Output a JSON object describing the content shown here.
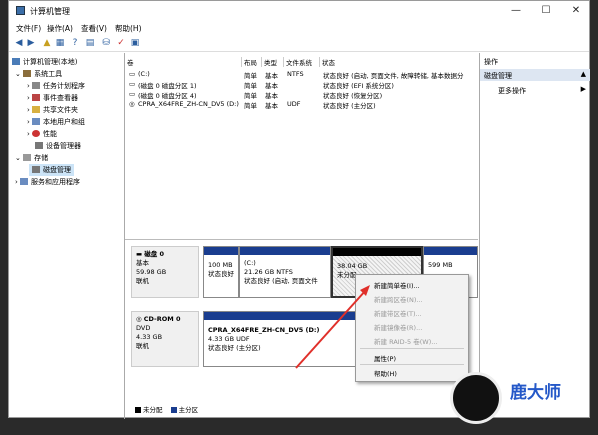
{
  "window": {
    "title": "计算机管理",
    "minimize": "—",
    "maximize": "☐",
    "close": "✕"
  },
  "menu": [
    "文件(F)",
    "操作(A)",
    "查看(V)",
    "帮助(H)"
  ],
  "tree": {
    "root": "计算机管理(本地)",
    "system_tools": "系统工具",
    "task_scheduler": "任务计划程序",
    "event_viewer": "事件查看器",
    "shared_folders": "共享文件夹",
    "local_users": "本地用户和组",
    "performance": "性能",
    "device_manager": "设备管理器",
    "storage": "存储",
    "disk_mgmt": "磁盘管理",
    "services": "服务和应用程序"
  },
  "volumes": {
    "headers": [
      "卷",
      "布局",
      "类型",
      "文件系统",
      "状态"
    ],
    "rows": [
      [
        "(C:)",
        "简单",
        "基本",
        "NTFS",
        "状态良好 (启动, 页面文件, 故障转储, 基本数据分"
      ],
      [
        "(磁盘 0 磁盘分区 1)",
        "简单",
        "基本",
        "",
        "状态良好 (EFI 系统分区)"
      ],
      [
        "(磁盘 0 磁盘分区 4)",
        "简单",
        "基本",
        "",
        "状态良好 (恢复分区)"
      ],
      [
        "CPRA_X64FRE_ZH-CN_DV5 (D:)",
        "简单",
        "基本",
        "UDF",
        "状态良好 (主分区)"
      ]
    ]
  },
  "disk0": {
    "name": "磁盘 0",
    "type": "基本",
    "size": "59.98 GB",
    "status": "联机",
    "p1": {
      "size": "100 MB",
      "status": "状态良好"
    },
    "p2": {
      "name": "(C:)",
      "size": "21.26 GB NTFS",
      "status": "状态良好 (启动, 页面文件"
    },
    "p3": {
      "size": "38.04 GB",
      "status": "未分配"
    },
    "p4": {
      "size": "599 MB"
    }
  },
  "cdrom": {
    "name": "CD-ROM 0",
    "type": "DVD",
    "size": "4.33 GB",
    "status": "联机",
    "volume": {
      "name": "CPRA_X64FRE_ZH-CN_DV5 (D:)",
      "size": "4.33 GB UDF",
      "status": "状态良好 (主分区)"
    }
  },
  "legend": {
    "unalloc": "未分配",
    "primary": "主分区"
  },
  "actions": {
    "header": "操作",
    "section": "磁盘管理",
    "more": "更多操作"
  },
  "context_menu": {
    "items": [
      "新建简单卷(I)...",
      "新建跨区卷(N)...",
      "新建带区卷(T)...",
      "新建镜像卷(R)...",
      "新建 RAID-5 卷(W)...",
      "属性(P)",
      "帮助(H)"
    ]
  },
  "watermark": {
    "title": "鹿大师",
    "url": "Ludashiwj.com"
  },
  "colors": {
    "primary": "#1a3d8f",
    "black_bar": "#000000",
    "arrow": "#e0302a"
  }
}
